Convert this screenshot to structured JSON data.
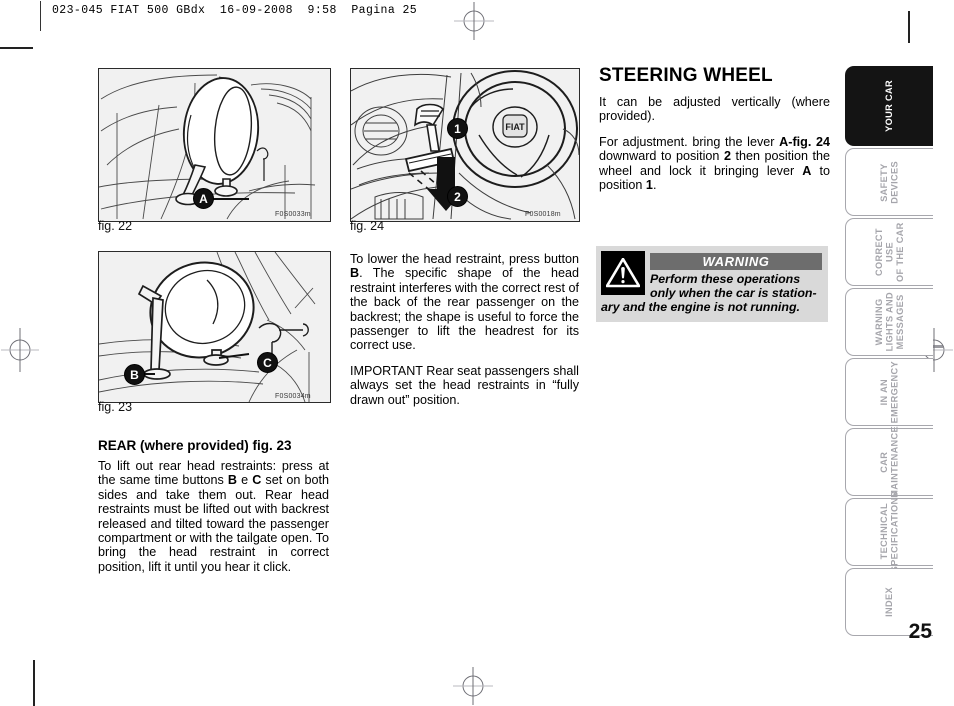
{
  "slug": {
    "text": "023-045 FIAT 500 GBdx  16-09-2008  9:58  Pagina 25"
  },
  "figures": [
    {
      "name": "fig-22",
      "caption": "fig. 22",
      "code": "F0S0033m",
      "callouts": [
        "A"
      ]
    },
    {
      "name": "fig-23",
      "caption": "fig. 23",
      "code": "F0S0034m",
      "callouts": [
        "B",
        "C"
      ]
    },
    {
      "name": "fig-24",
      "caption": "fig. 24",
      "code": "F0S0018m",
      "callouts": [
        "1",
        "2"
      ]
    }
  ],
  "middle_column": {
    "paragraph_1_a": "To lower the head restraint, press button ",
    "paragraph_1_b": "B",
    "paragraph_1_c": ". The specific shape of the head restraint interferes with the correct rest of the back of the rear passenger on the backrest; the shape is useful to force the passenger to lift the headrest for its correct use.",
    "paragraph_2": "IMPORTANT Rear seat passengers shall always set the head restraints in “fully drawn out” position."
  },
  "left_column": {
    "heading_bold": "REAR",
    "heading_rest": " (where provided) fig. 23",
    "paragraph_a": "To lift out rear head restraints: press at the same time buttons ",
    "paragraph_b1": "B",
    "paragraph_b2": " e ",
    "paragraph_b3": "C",
    "paragraph_c": " set on both sides and take them out. Rear head restraints must be lifted out with backrest released and tilted toward the passenger compartment or with the tailgate open. To bring the head restraint in correct position, lift it until you hear it click."
  },
  "right_column": {
    "title": "STEERING WHEEL",
    "paragraph_1": "It can be adjusted vertically (where provided).",
    "p2_a": "For adjustment. bring the lever ",
    "p2_b": "A-fig. 24",
    "p2_c": " downward to position ",
    "p2_d": "2",
    "p2_e": " then position the wheel and lock it bringing lever ",
    "p2_f": "A",
    "p2_g": " to position ",
    "p2_h": "1",
    "p2_i": "."
  },
  "warning": {
    "header": "WARNING",
    "line_1": "Perform these operations",
    "line_2": "only when the car is station-",
    "line_3": "ary and the engine is not running.",
    "icon": "warning-triangle-icon",
    "bg_color": "#d9d9d9",
    "header_color": "#6d6d6d"
  },
  "side_tabs": [
    {
      "label": "YOUR CAR",
      "active": true
    },
    {
      "label": "SAFETY\nDEVICES",
      "active": false
    },
    {
      "label": "CORRECT USE\nOF THE CAR",
      "active": false
    },
    {
      "label": "WARNING\nLIGHTS AND\nMESSAGES",
      "active": false
    },
    {
      "label": "IN AN\nEMERGENCY",
      "active": false
    },
    {
      "label": "CAR\nMAINTENANCE",
      "active": false
    },
    {
      "label": "TECHNICAL\nSPECIFICATIONS",
      "active": false
    },
    {
      "label": "INDEX",
      "active": false
    }
  ],
  "page_number": "25"
}
